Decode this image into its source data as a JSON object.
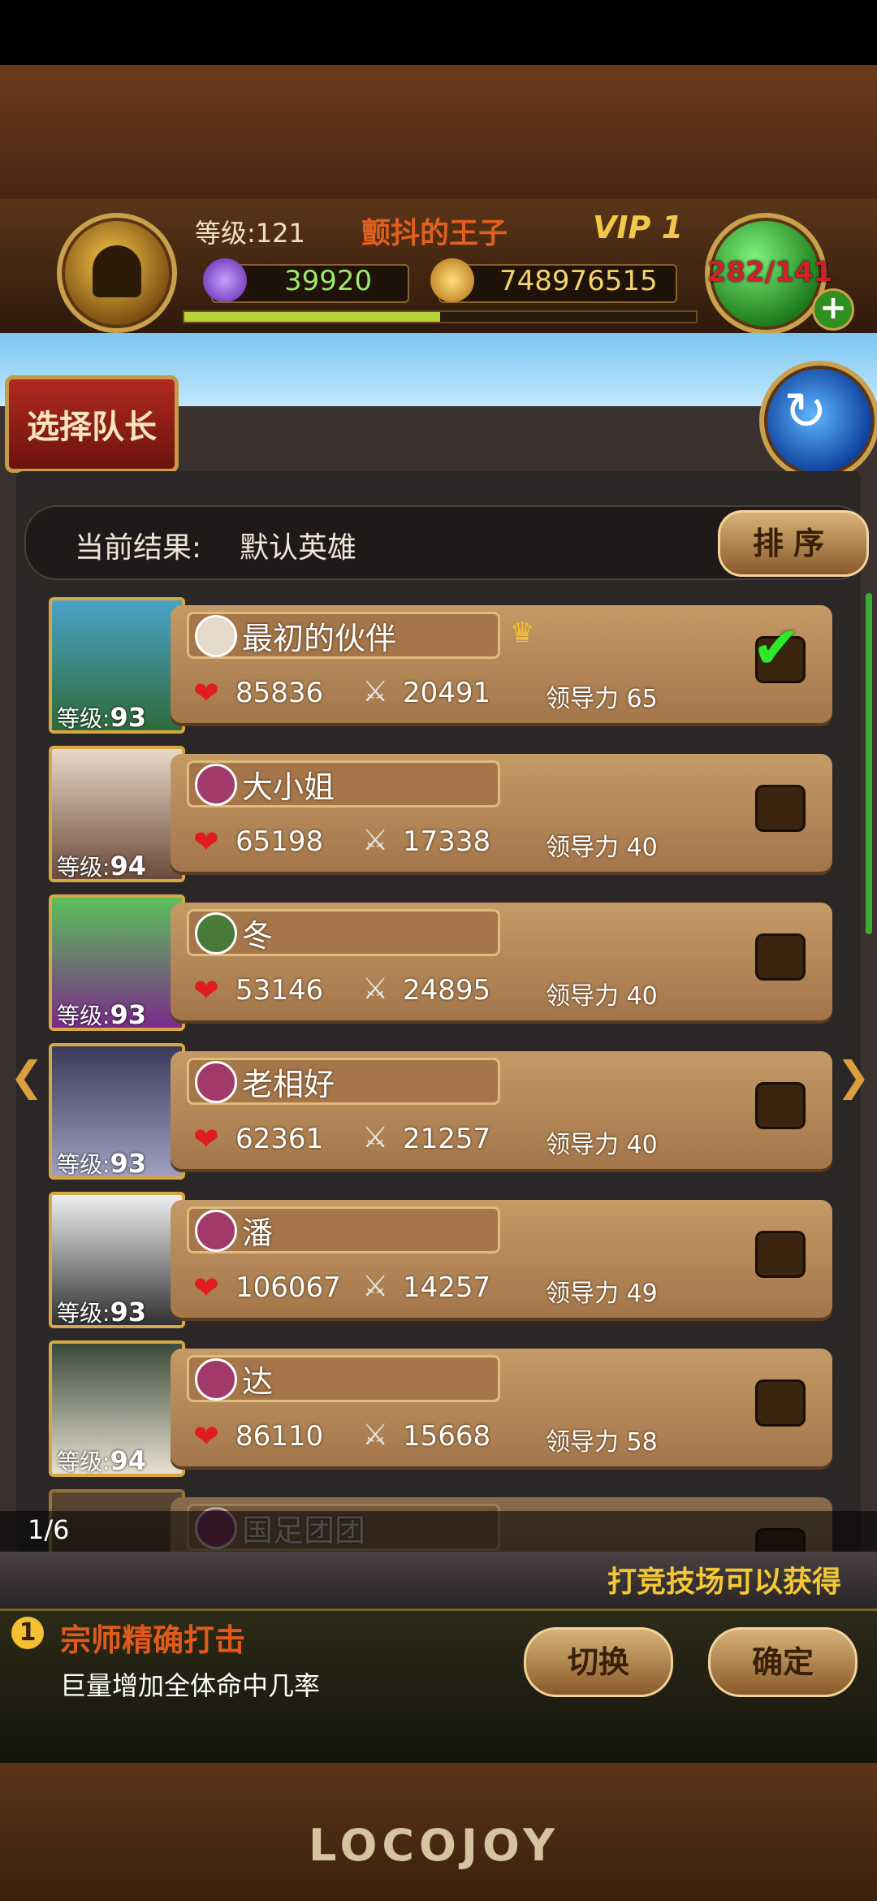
{
  "header": {
    "level_label": "等级:121",
    "player_name": "颤抖的王子",
    "vip": "VIP 1",
    "gems": "39920",
    "coins": "748976515",
    "stamina": "282/141",
    "xp_fraction": 0.5
  },
  "top": {
    "select_leader_label": "选择队长"
  },
  "result": {
    "label": "当前结果:",
    "value": "默认英雄",
    "sort_label": "排序"
  },
  "heroes": [
    {
      "name": "最初的伙伴",
      "level": "93",
      "hp": "85836",
      "atk": "20491",
      "leadership": "领导力 65",
      "selected": true,
      "crown": true
    },
    {
      "name": "大小姐",
      "level": "94",
      "hp": "65198",
      "atk": "17338",
      "leadership": "领导力 40",
      "selected": false
    },
    {
      "name": "冬",
      "level": "93",
      "hp": "53146",
      "atk": "24895",
      "leadership": "领导力 40",
      "selected": false
    },
    {
      "name": "老相好",
      "level": "93",
      "hp": "62361",
      "atk": "21257",
      "leadership": "领导力 40",
      "selected": false
    },
    {
      "name": "潘",
      "level": "93",
      "hp": "106067",
      "atk": "14257",
      "leadership": "领导力 49",
      "selected": false
    },
    {
      "name": "达",
      "level": "94",
      "hp": "86110",
      "atk": "15668",
      "leadership": "领导力 58",
      "selected": false
    },
    {
      "name": "国足团团"
    }
  ],
  "level_prefix": "等级:",
  "pager": {
    "page": "1/6"
  },
  "ticker": "打竞技场可以获得",
  "skill": {
    "number": "1",
    "name": "宗师精确打击",
    "description": "巨量增加全体命中几率",
    "switch_label": "切换",
    "confirm_label": "确定"
  },
  "logo": "LOCOJOY"
}
